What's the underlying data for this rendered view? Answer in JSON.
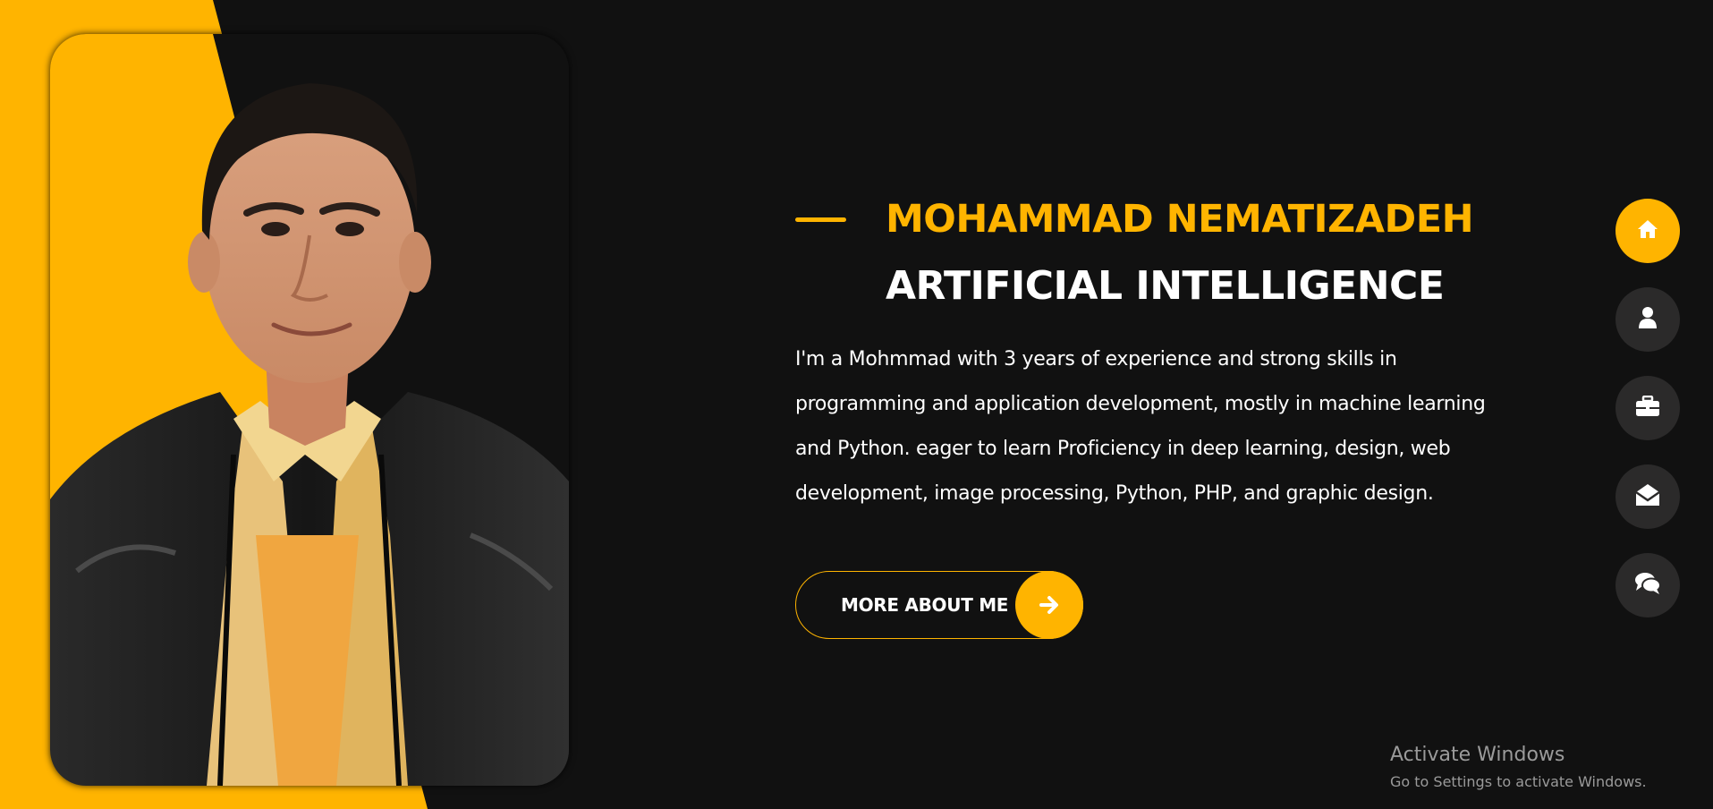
{
  "hero": {
    "name": "MOHAMMAD NEMATIZADEH",
    "role": "ARTIFICIAL INTELLIGENCE",
    "bio": "I'm a Mohmmad with 3 years of experience and strong skills in programming and application development, mostly in machine learning and Python. eager to learn Proficiency in deep learning, design, web development, image processing, Python, PHP, and graphic design.",
    "more_button_label": "MORE ABOUT ME"
  },
  "side_nav": {
    "items": [
      {
        "icon": "home-icon",
        "active": true
      },
      {
        "icon": "user-icon",
        "active": false
      },
      {
        "icon": "briefcase-icon",
        "active": false
      },
      {
        "icon": "envelope-open-icon",
        "active": false
      },
      {
        "icon": "comments-icon",
        "active": false
      }
    ]
  },
  "watermark": {
    "title": "Activate Windows",
    "subtitle": "Go to Settings to activate Windows."
  },
  "colors": {
    "accent": "#ffb400",
    "background": "#111111",
    "nav_inactive": "#2b2a2a",
    "text": "#ffffff"
  }
}
